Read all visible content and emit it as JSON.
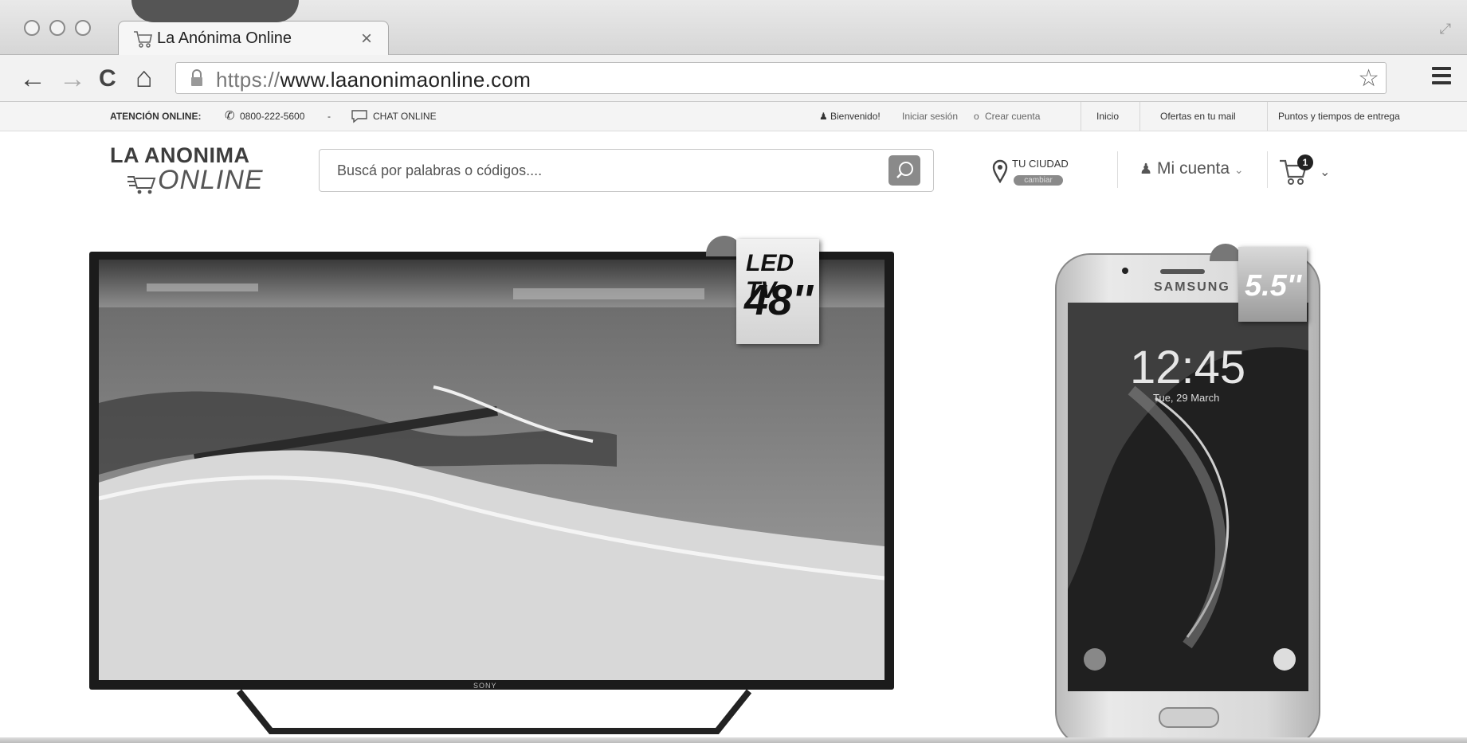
{
  "browser": {
    "tab_title": "La Anónima Online",
    "tab_close": "×",
    "url_scheme": "https://",
    "url_host": "www.laanonimaonline.com",
    "back_glyph": "←",
    "forward_glyph": "→",
    "reload_glyph": "C",
    "home_glyph": "⌂",
    "star_glyph": "☆"
  },
  "topbar": {
    "attention_label": "ATENCIÓN ONLINE:",
    "phone": "0800-222-5600",
    "dash": "-",
    "chat": "CHAT ONLINE",
    "welcome": "Bienvenido!",
    "login": "Iniciar sesión",
    "or": "o",
    "register": "Crear cuenta",
    "links": [
      "Inicio",
      "Ofertas en tu mail",
      "Puntos y tiempos de entrega"
    ]
  },
  "header": {
    "logo_line1": "LA ANONIMA",
    "logo_line2": "ONLINE",
    "search_placeholder": "Buscá por palabras o códigos....",
    "city_label": "TU CIUDAD",
    "city_change": "cambiar",
    "account_label": "Mi cuenta",
    "account_chevron": "⌄",
    "cart_count": "1",
    "cart_chevron": "⌄"
  },
  "banner": {
    "tv_tag_line1": "LED TV",
    "tv_tag_line2": "48''",
    "tv_brand": "SONY",
    "phone_brand": "SAMSUNG",
    "phone_time": "12:45",
    "phone_date": "Tue, 29 March",
    "phone_tag": "5.5''"
  }
}
